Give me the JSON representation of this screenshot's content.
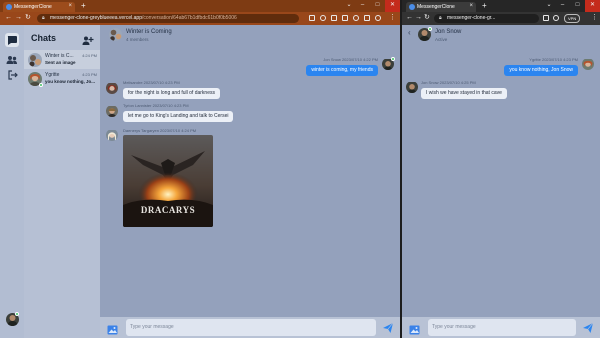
{
  "left_window": {
    "tab": {
      "title": "MessengerClone"
    },
    "url": {
      "host": "messenger-clone-greyblueeea.vercel.app",
      "path": "/conversation/64ab67b1dfbdc61b0f0b5006"
    },
    "rail_icons": [
      "chat-icon",
      "users-icon",
      "logout-icon"
    ],
    "sidebar": {
      "title": "Chats",
      "conversations": [
        {
          "name": "Winter is C...",
          "time": "4:24 PM",
          "last": "Sent an image"
        },
        {
          "name": "Ygritte",
          "time": "4:23 PM",
          "last": "you know nothing, Jo..."
        }
      ]
    },
    "chat": {
      "title": "Winter is Coming",
      "subtitle": "4 members",
      "messages": [
        {
          "meta": "Jon Snow  2023/07/10 4:22 PM",
          "text": "winter is coming, my friends"
        },
        {
          "meta": "Melisandre  2023/07/10 4:23 PM",
          "text": "for the night is long and full of darkness"
        },
        {
          "meta": "Tyrion Lannister  2023/07/10 4:23 PM",
          "text": "let me go to King's Landing and talk to Cersei"
        },
        {
          "meta": "Daenerys Targaryen  2023/07/10 4:24 PM",
          "image_caption": "DRACARYS"
        }
      ],
      "input_placeholder": "Type your message"
    }
  },
  "right_window": {
    "tab": {
      "title": "MessengerClone"
    },
    "url": {
      "host": "messenger-clone-gr..."
    },
    "toolbar": {
      "vpn": "VPN"
    },
    "chat": {
      "title": "Jon Snow",
      "subtitle": "Active",
      "messages": [
        {
          "meta": "Ygritte  2023/07/10 4:23 PM",
          "text": "you know nothing, Jon Snow"
        },
        {
          "meta": "Jon Snow  2023/07/10 4:25 PM",
          "text": "I wish we have stayed in that cave"
        }
      ],
      "input_placeholder": "Type your message"
    }
  },
  "colors": {
    "accent": "#2b85f0",
    "chat_bg": "#94a1bc",
    "sidebar_bg": "#b6c0d4",
    "left_chrome": "#7e3b13",
    "right_chrome": "#262626",
    "online": "#3fbf64"
  }
}
